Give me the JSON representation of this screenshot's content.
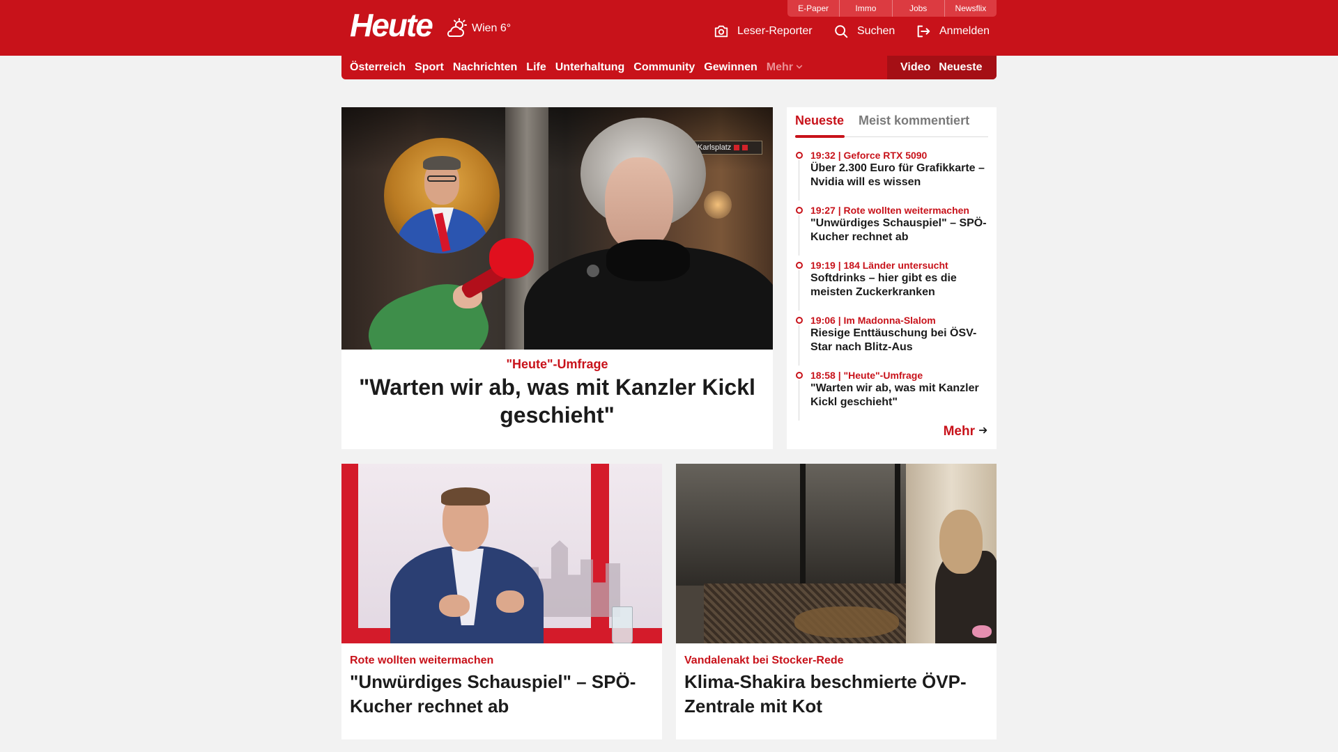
{
  "colors": {
    "brand_red": "#c8121a",
    "nav_dark_red": "#a50f15",
    "tab_red": "#dc3b41",
    "text": "#1b1b1b",
    "muted": "#7a7a7a",
    "background": "#f2f2f2"
  },
  "header": {
    "logo": "Heute",
    "weather": {
      "icon": "cloud-sun-icon",
      "text": "Wien 6°"
    },
    "top_links": [
      "E-Paper",
      "Immo",
      "Jobs",
      "Newsflix"
    ],
    "actions": [
      {
        "icon": "camera-icon",
        "label": "Leser-Reporter"
      },
      {
        "icon": "search-icon",
        "label": "Suchen"
      },
      {
        "icon": "login-icon",
        "label": "Anmelden"
      }
    ]
  },
  "nav": {
    "items": [
      "Österreich",
      "Sport",
      "Nachrichten",
      "Life",
      "Unterhaltung",
      "Community",
      "Gewinnen"
    ],
    "more": "Mehr",
    "right": [
      "Video",
      "Neueste"
    ]
  },
  "hero": {
    "image_sign": "Karlsplatz",
    "kicker": "\"Heute\"-Umfrage",
    "headline": "\"Warten wir ab, was mit Kanzler Kickl geschieht\""
  },
  "sidebar": {
    "tabs": [
      "Neueste",
      "Meist kommentiert"
    ],
    "active_tab": "Neueste",
    "items": [
      {
        "meta": "19:32 | Geforce RTX 5090",
        "title": "Über 2.300 Euro für Grafikkarte – Nvidia will es wissen"
      },
      {
        "meta": "19:27 | Rote wollten weitermachen",
        "title": "\"Unwürdiges Schauspiel\" – SPÖ-Kucher rechnet ab"
      },
      {
        "meta": "19:19 | 184 Länder untersucht",
        "title": "Softdrinks – hier gibt es die meisten Zuckerkranken"
      },
      {
        "meta": "19:06 | Im Madonna-Slalom",
        "title": "Riesige Enttäuschung bei ÖSV-Star nach Blitz-Aus"
      },
      {
        "meta": "18:58 | \"Heute\"-Umfrage",
        "title": "\"Warten wir ab, was mit Kanzler Kickl geschieht\""
      }
    ],
    "more": "Mehr"
  },
  "cards": [
    {
      "kicker": "Rote wollten weitermachen",
      "headline": "\"Unwürdiges Schauspiel\" – SPÖ-Kucher rechnet ab"
    },
    {
      "kicker": "Vandalenakt bei Stocker-Rede",
      "headline": "Klima-Shakira beschmierte ÖVP-Zentrale mit Kot"
    }
  ]
}
